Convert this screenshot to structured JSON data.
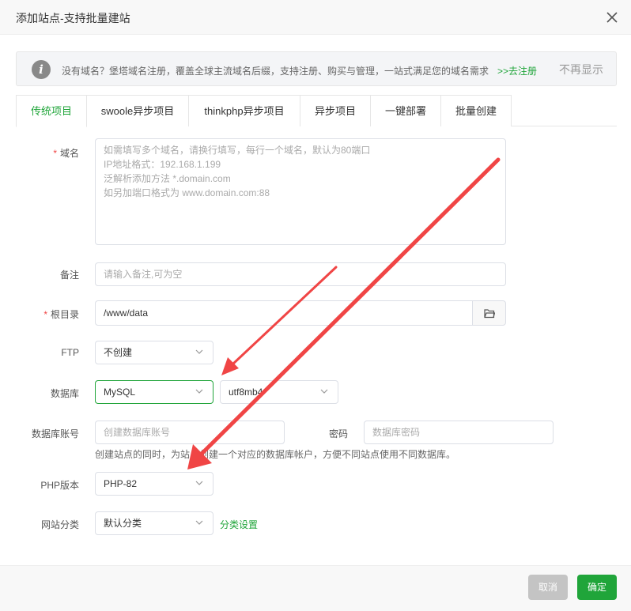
{
  "window": {
    "title": "添加站点-支持批量建站"
  },
  "notice": {
    "text": "没有域名？堡塔域名注册，覆盖全球主流域名后缀，支持注册、购买与管理，一站式满足您的域名需求",
    "link": ">>去注册",
    "dismiss": "不再显示"
  },
  "tabs": [
    {
      "label": "传统项目"
    },
    {
      "label": "swoole异步项目"
    },
    {
      "label": "thinkphp异步项目"
    },
    {
      "label": "异步项目"
    },
    {
      "label": "一键部署"
    },
    {
      "label": "批量创建"
    }
  ],
  "form": {
    "domain": {
      "label": "域名",
      "required": "*",
      "placeholder_lines": [
        "如需填写多个域名，请换行填写，每行一个域名，默认为80端口",
        "IP地址格式：192.168.1.199",
        "泛解析添加方法 *.domain.com",
        "如另加端口格式为 www.domain.com:88"
      ]
    },
    "remark": {
      "label": "备注",
      "placeholder": "请输入备注,可为空"
    },
    "root": {
      "label": "根目录",
      "required": "*",
      "value": "/www/data"
    },
    "ftp": {
      "label": "FTP",
      "value": "不创建"
    },
    "database": {
      "label": "数据库",
      "type": "MySQL",
      "charset": "utf8mb4"
    },
    "db_account": {
      "label": "数据库账号",
      "placeholder": "创建数据库账号"
    },
    "db_password": {
      "label": "密码",
      "placeholder": "数据库密码"
    },
    "db_hint": "创建站点的同时，为站点创建一个对应的数据库帐户，方便不同站点使用不同数据库。",
    "php": {
      "label": "PHP版本",
      "value": "PHP-82"
    },
    "category": {
      "label": "网站分类",
      "value": "默认分类",
      "link": "分类设置"
    }
  },
  "footer": {
    "cancel": "取消",
    "confirm": "确定"
  },
  "colors": {
    "accent": "#20a53a",
    "annotation": "#f04545"
  }
}
